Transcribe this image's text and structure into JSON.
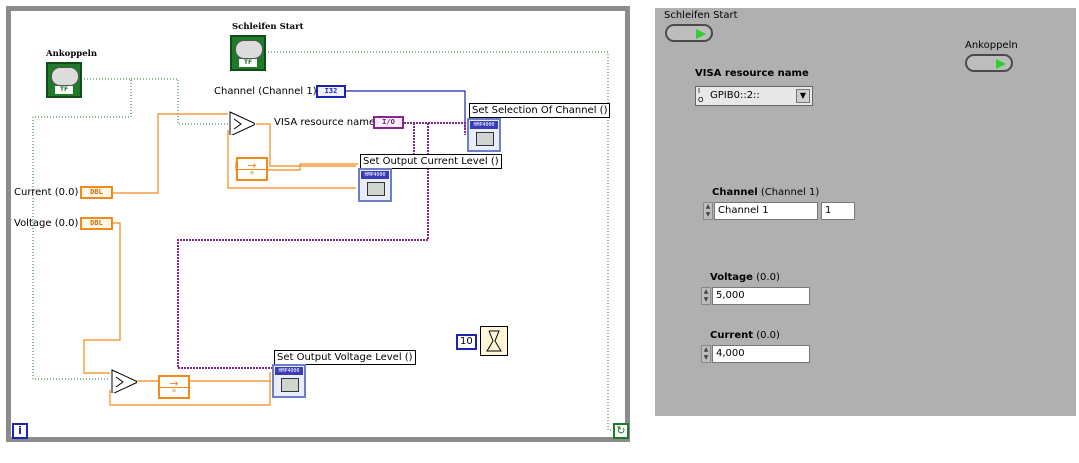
{
  "block_diagram": {
    "schleifen_start_label": "Schleifen Start",
    "ankoppeln_label": "Ankoppeln",
    "channel_label": "Channel (Channel 1)",
    "channel_type": "I32",
    "visa_label": "VISA resource name",
    "visa_type": "I/O",
    "current_label": "Current (0.0)",
    "current_type": "DBL",
    "voltage_label": "Voltage (0.0)",
    "voltage_type": "DBL",
    "vi_set_selection": "Set Selection Of Channel ()",
    "vi_set_current": "Set Output Current Level ()",
    "vi_set_voltage": "Set Output Voltage Level ()",
    "vi_icon_text": "HMP4000",
    "wait_constant": "10",
    "iteration_symbol": "i",
    "bool_tf": "TF",
    "case_symbol": "*"
  },
  "front_panel": {
    "schleifen_start_label": "Schleifen Start",
    "ankoppeln_label": "Ankoppeln",
    "visa_label": "VISA resource name",
    "visa_value": "GPIB0::2::",
    "channel_label_bold": "Channel",
    "channel_label_rest": " (Channel 1)",
    "channel_value": "Channel 1",
    "channel_index": "1",
    "voltage_label_bold": "Voltage",
    "voltage_label_rest": " (0.0)",
    "voltage_value": "5,000",
    "current_label_bold": "Current",
    "current_label_rest": " (0.0)",
    "current_value": "4,000"
  },
  "colors": {
    "loop_border": "#8c8c8c",
    "dbl_wire": "#f08a1a",
    "i32_wire": "#1a24b0",
    "visa_wire": "#8a2590",
    "bool_wire": "#1f7a2a",
    "panel_bg": "#b0b0b0"
  }
}
